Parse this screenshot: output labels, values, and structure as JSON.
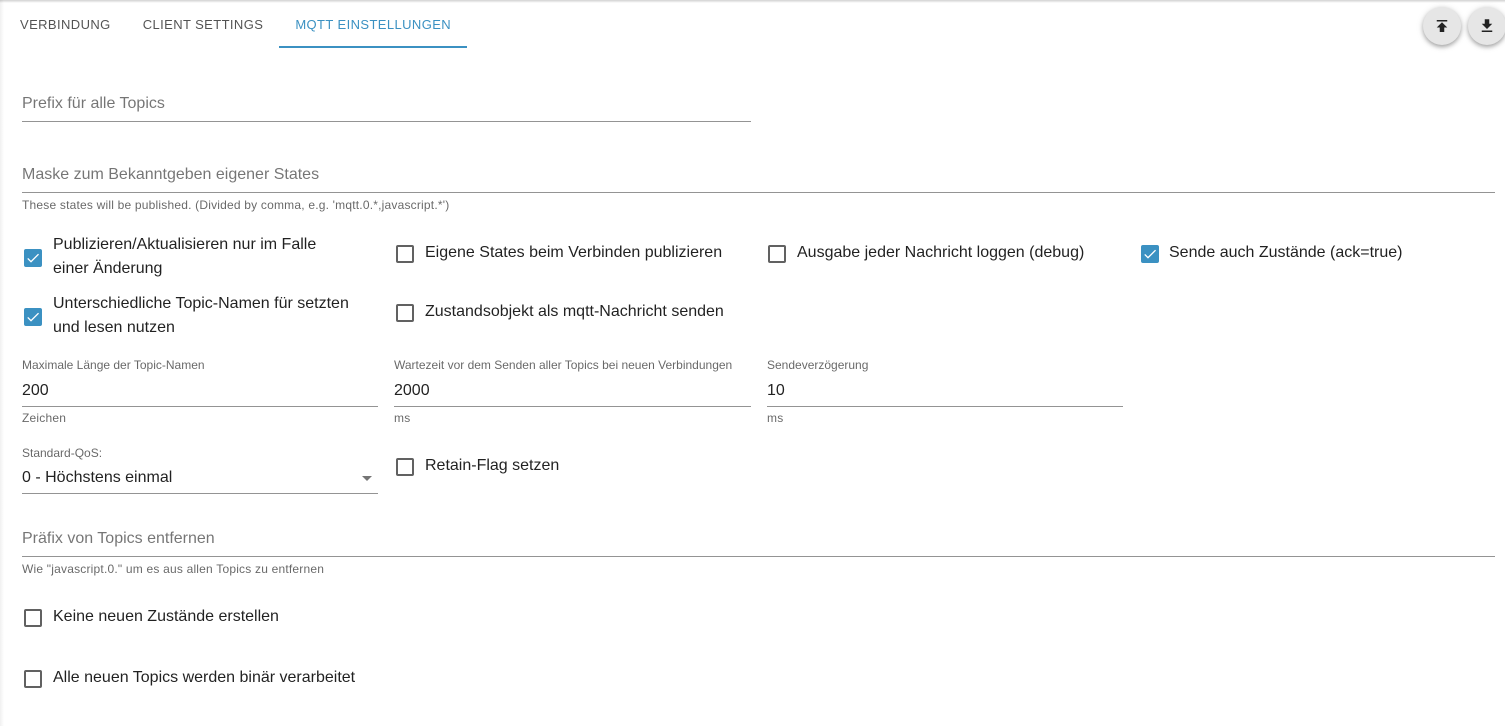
{
  "tabs": [
    {
      "label": "VERBINDUNG"
    },
    {
      "label": "CLIENT SETTINGS"
    },
    {
      "label": "MQTT EINSTELLUNGEN"
    }
  ],
  "prefix_field": {
    "placeholder": "Prefix für alle Topics",
    "value": ""
  },
  "mask_field": {
    "placeholder": "Maske zum Bekanntgeben eigener States",
    "helper": "These states will be published. (Divided by comma, e.g. 'mqtt.0.*,javascript.*')",
    "value": ""
  },
  "checkboxes": {
    "publish_on_change": {
      "label_line1": "Publizieren/Aktualisieren nur im Falle",
      "label_line2": "einer Änderung",
      "checked": true
    },
    "publish_own_on_connect": {
      "label": "Eigene States beim Verbinden publizieren",
      "checked": false
    },
    "debug_log": {
      "label": "Ausgabe jeder Nachricht loggen (debug)",
      "checked": false
    },
    "send_ack_true": {
      "label": "Sende auch Zustände (ack=true)",
      "checked": true
    },
    "different_topic_names": {
      "label_line1": "Unterschiedliche Topic-Namen für setzten",
      "label_line2": "und lesen nutzen",
      "checked": true
    },
    "state_object_as_message": {
      "label": "Zustandsobjekt als mqtt-Nachricht senden",
      "checked": false
    },
    "retain_flag": {
      "label": "Retain-Flag setzen",
      "checked": false
    },
    "no_new_states": {
      "label": "Keine neuen Zustände erstellen",
      "checked": false
    },
    "binary_topics": {
      "label": "Alle neuen Topics werden binär verarbeitet",
      "checked": false
    }
  },
  "max_topic_length": {
    "label": "Maximale Länge der Topic-Namen",
    "value": "200",
    "unit": "Zeichen"
  },
  "wait_time": {
    "label": "Wartezeit vor dem Senden aller Topics bei neuen Verbindungen",
    "value": "2000",
    "unit": "ms"
  },
  "send_delay": {
    "label": "Sendeverzögerung",
    "value": "10",
    "unit": "ms"
  },
  "qos": {
    "label": "Standard-QoS:",
    "value": "0 - Höchstens einmal"
  },
  "remove_prefix": {
    "placeholder": "Präfix von Topics entfernen",
    "helper": "Wie \"javascript.0.\" um es aus allen Topics zu entfernen",
    "value": ""
  },
  "buttons": {
    "upload_icon": "upload-icon",
    "download_icon": "download-icon"
  },
  "colors": {
    "accent": "#3b91c2"
  }
}
